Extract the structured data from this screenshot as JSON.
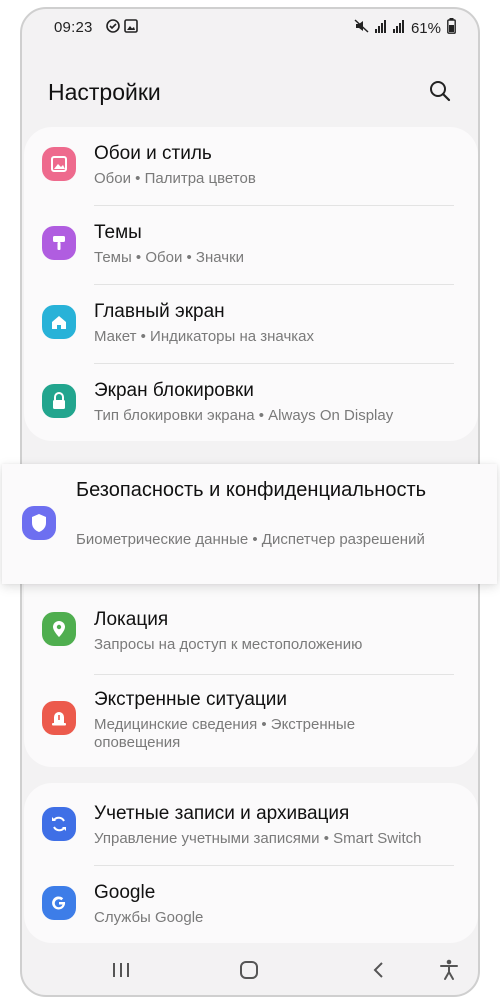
{
  "status": {
    "time": "09:23",
    "battery": "61%",
    "icons_left": [
      "at-sign-icon",
      "image-icon"
    ],
    "icons_right": [
      "mute-icon",
      "signal-icon",
      "signal-icon",
      "battery-icon"
    ]
  },
  "header": {
    "title": "Настройки",
    "search_icon": "search-icon"
  },
  "groups": [
    {
      "items": [
        {
          "title": "Обои и стиль",
          "subtitle": "Обои  •  Палитра цветов",
          "icon": "wallpaper-icon",
          "color": "#ee6a8d"
        },
        {
          "title": "Темы",
          "subtitle": "Темы  •  Обои  •  Значки",
          "icon": "themes-icon",
          "color": "#b05de0"
        },
        {
          "title": "Главный экран",
          "subtitle": "Макет  •  Индикаторы на значках",
          "icon": "home-icon",
          "color": "#28b2d8"
        },
        {
          "title": "Экран блокировки",
          "subtitle": "Тип блокировки экрана  •  Always On Display",
          "icon": "lock-icon",
          "color": "#22a58e"
        }
      ]
    },
    {
      "highlighted": {
        "title": "Безопасность и конфиденциальность",
        "subtitle": "Биометрические данные  •  Диспетчер разрешений",
        "icon": "shield-icon",
        "color": "#6d6ff0"
      },
      "items": [
        {
          "title": "Локация",
          "subtitle": "Запросы на доступ к местоположению",
          "icon": "location-icon",
          "color": "#4fae4f"
        },
        {
          "title": "Экстренные ситуации",
          "subtitle": "Медицинские сведения  •  Экстренные оповещения",
          "icon": "emergency-icon",
          "color": "#ec5a4c"
        }
      ]
    },
    {
      "items": [
        {
          "title": "Учетные записи и архивация",
          "subtitle": "Управление учетными записями  •  Smart Switch",
          "icon": "sync-icon",
          "color": "#3f6fe6"
        },
        {
          "title": "Google",
          "subtitle": "Службы Google",
          "icon": "google-icon",
          "color": "#3d7de8"
        }
      ]
    }
  ],
  "navbar": {
    "buttons": [
      "recents-icon",
      "home-button-icon",
      "back-icon",
      "accessibility-icon"
    ]
  }
}
